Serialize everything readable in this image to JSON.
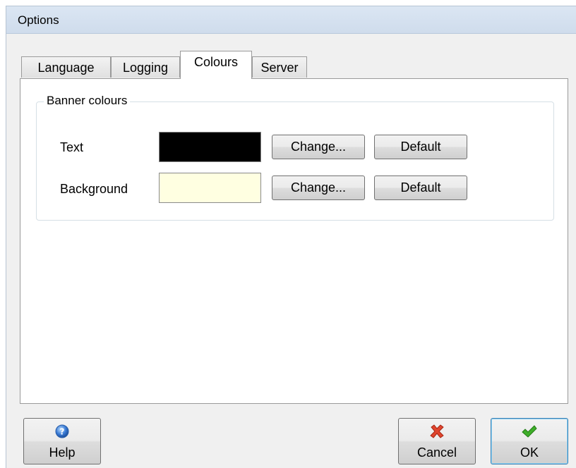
{
  "window": {
    "title": "Options"
  },
  "tabs": [
    {
      "label": "Language",
      "active": false
    },
    {
      "label": "Logging",
      "active": false
    },
    {
      "label": "Colours",
      "active": true
    },
    {
      "label": "Server",
      "active": false
    }
  ],
  "banner_colours": {
    "group_title": "Banner colours",
    "rows": [
      {
        "label": "Text",
        "color": "#000000",
        "change_label": "Change...",
        "default_label": "Default"
      },
      {
        "label": "Background",
        "color": "#ffffe1",
        "change_label": "Change...",
        "default_label": "Default"
      }
    ]
  },
  "footer": {
    "help_label": "Help",
    "help_icon": "help-icon",
    "cancel_label": "Cancel",
    "cancel_icon": "red-x-icon",
    "ok_label": "OK",
    "ok_icon": "green-check-icon"
  },
  "colors": {
    "help_icon": "#3a7bd5",
    "cancel_icon": "#e0452e",
    "ok_icon": "#3fae2a"
  }
}
